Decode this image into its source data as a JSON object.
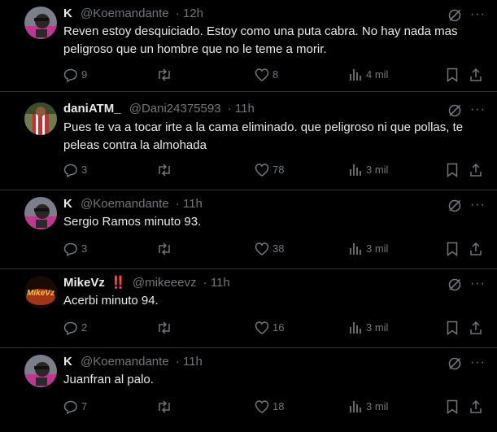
{
  "colors": {
    "background": "#000000",
    "text": "#e7e9ea",
    "muted": "#71767b",
    "separator": "#2f3336",
    "verified_red": "#f4212e"
  },
  "tweets": [
    {
      "name": "K",
      "handle": "@Koemandante",
      "time": "· 12h",
      "text": "Reven estoy desquiciado. Estoy como una puta cabra. No hay nada mas peligroso que un hombre que no le teme a morir.",
      "replies": "9",
      "likes": "8",
      "views": "4 mil",
      "avatar_icon": "user-avatar-k"
    },
    {
      "name": "daniATM_",
      "handle": "@Dani24375593",
      "time": "· 11h",
      "text": "Pues te va a tocar irte a la cama eliminado. que peligroso ni que pollas, te peleas contra la almohada",
      "replies": "3",
      "likes": "78",
      "views": "3 mil",
      "avatar_icon": "user-avatar-dani"
    },
    {
      "name": "K",
      "handle": "@Koemandante",
      "time": "· 11h",
      "text": "Sergio Ramos minuto 93.",
      "replies": "3",
      "likes": "38",
      "views": "3 mil",
      "avatar_icon": "user-avatar-k"
    },
    {
      "name": "MikeVz",
      "badge": "‼️",
      "handle": "@mikeeevz",
      "time": "· 11h",
      "text": "Acerbi minuto 94.",
      "replies": "2",
      "likes": "16",
      "views": "3 mil",
      "avatar_icon": "user-avatar-mike",
      "avatar_logo_text": "MikeVz"
    },
    {
      "name": "K",
      "handle": "@Koemandante",
      "time": "· 11h",
      "text": "Juanfran al palo.",
      "replies": "7",
      "likes": "18",
      "views": "3 mil",
      "avatar_icon": "user-avatar-k"
    }
  ],
  "icons": [
    "reply-icon",
    "retweet-icon",
    "like-icon",
    "views-icon",
    "bookmark-icon",
    "share-icon",
    "grok-icon",
    "more-icon"
  ],
  "more_label": "···"
}
